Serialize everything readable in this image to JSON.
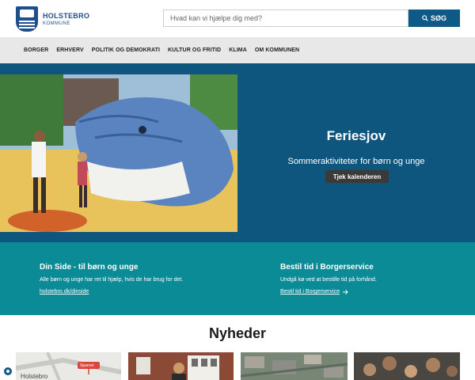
{
  "header": {
    "logo_name": "HOLSTEBRO",
    "logo_sub": "KOMMUNE",
    "search_placeholder": "Hvad kan vi hjælpe dig med?",
    "search_button": "SØG"
  },
  "nav": {
    "items": [
      "BORGER",
      "ERHVERV",
      "POLITIK OG DEMOKRATI",
      "KULTUR OG FRITID",
      "KLIMA",
      "OM KOMMUNEN"
    ]
  },
  "hero": {
    "title": "Feriesjov",
    "subtitle": "Sommeraktiviteter for børn og unge",
    "button": "Tjek kalenderen"
  },
  "cards": [
    {
      "title": "Din Side - til børn og unge",
      "text": "Alle børn og unge har ret til hjælp, hvis de har brug for det.",
      "link": "holstebro.dk/dinside"
    },
    {
      "title": "Bestil tid i Borgerservice",
      "text": "Undgå kø ved at bestille tid på forhånd.",
      "link": "Bestil tid i Borgerservice"
    }
  ],
  "news": {
    "title": "Nyheder",
    "thumb1_map_label": "Holstebro",
    "thumb1_map_tag": "Sparnet"
  },
  "colors": {
    "brand_blue": "#0e567e",
    "teal": "#0b8b96",
    "nav_bg": "#e8e8e8"
  }
}
